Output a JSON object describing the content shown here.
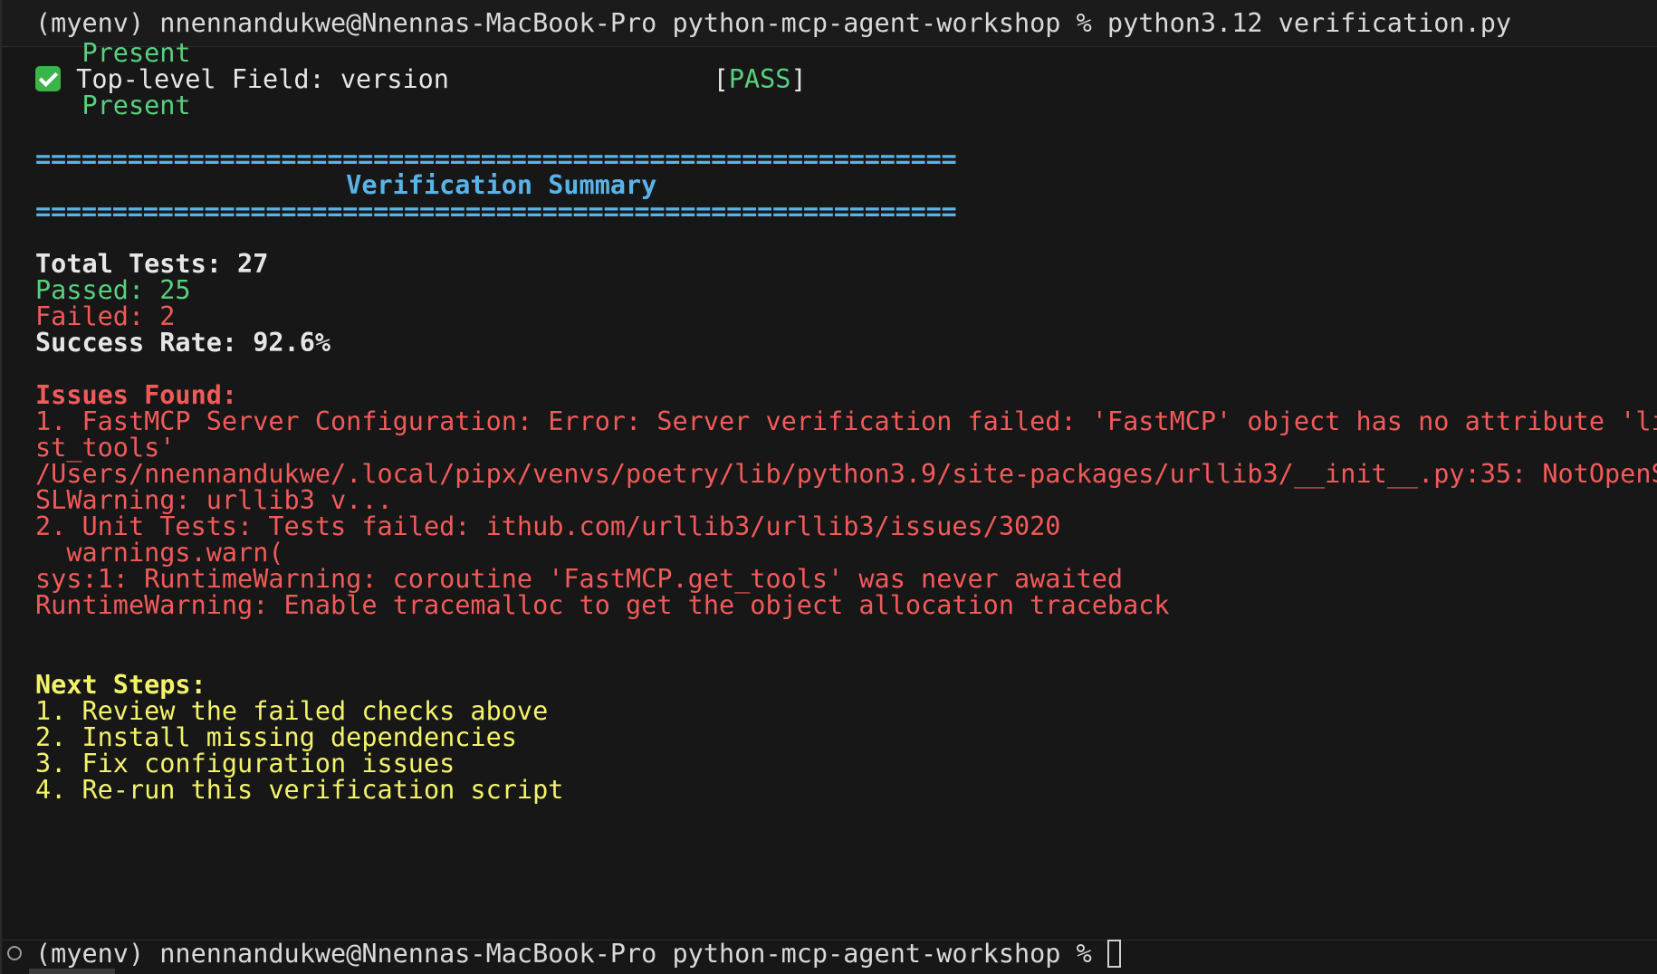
{
  "prompt": {
    "top": "(myenv) nnennandukwe@Nnennas-MacBook-Pro python-mcp-agent-workshop % python3.12 verification.py",
    "bottom": "(myenv) nnennandukwe@Nnennas-MacBook-Pro python-mcp-agent-workshop % "
  },
  "checks": {
    "present_1": "   Present",
    "field_label": " Top-level Field: version                 ",
    "field_status_open": "[",
    "field_status": "PASS",
    "field_status_close": "]",
    "present_2": "   Present"
  },
  "summary": {
    "separator": "============================================================",
    "title": "                    Verification Summary",
    "total": "Total Tests: 27",
    "passed": "Passed: 25",
    "failed": "Failed: 2",
    "success_rate": "Success Rate: 92.6%"
  },
  "issues": {
    "heading": "Issues Found:",
    "lines": [
      "1. FastMCP Server Configuration: Error: Server verification failed: 'FastMCP' object has no attribute 'li",
      "st_tools'",
      "/Users/nnennandukwe/.local/pipx/venvs/poetry/lib/python3.9/site-packages/urllib3/__init__.py:35: NotOpenS",
      "SLWarning: urllib3 v...",
      "2. Unit Tests: Tests failed: ithub.com/urllib3/urllib3/issues/3020",
      "  warnings.warn(",
      "sys:1: RuntimeWarning: coroutine 'FastMCP.get_tools' was never awaited",
      "RuntimeWarning: Enable tracemalloc to get the object allocation traceback"
    ]
  },
  "next_steps": {
    "heading": "Next Steps:",
    "items": [
      "1. Review the failed checks above",
      "2. Install missing dependencies",
      "3. Fix configuration issues",
      "4. Re-run this verification script"
    ]
  },
  "icons": {
    "check": "check-mark-icon",
    "status": "circle-status-icon",
    "cursor": "terminal-cursor"
  },
  "colors": {
    "background": "#171717",
    "pass_green": "#58d07d",
    "fail_red": "#f25a5a",
    "heading_cyan": "#5ab3e8",
    "steps_yellow": "#f3f36a"
  }
}
